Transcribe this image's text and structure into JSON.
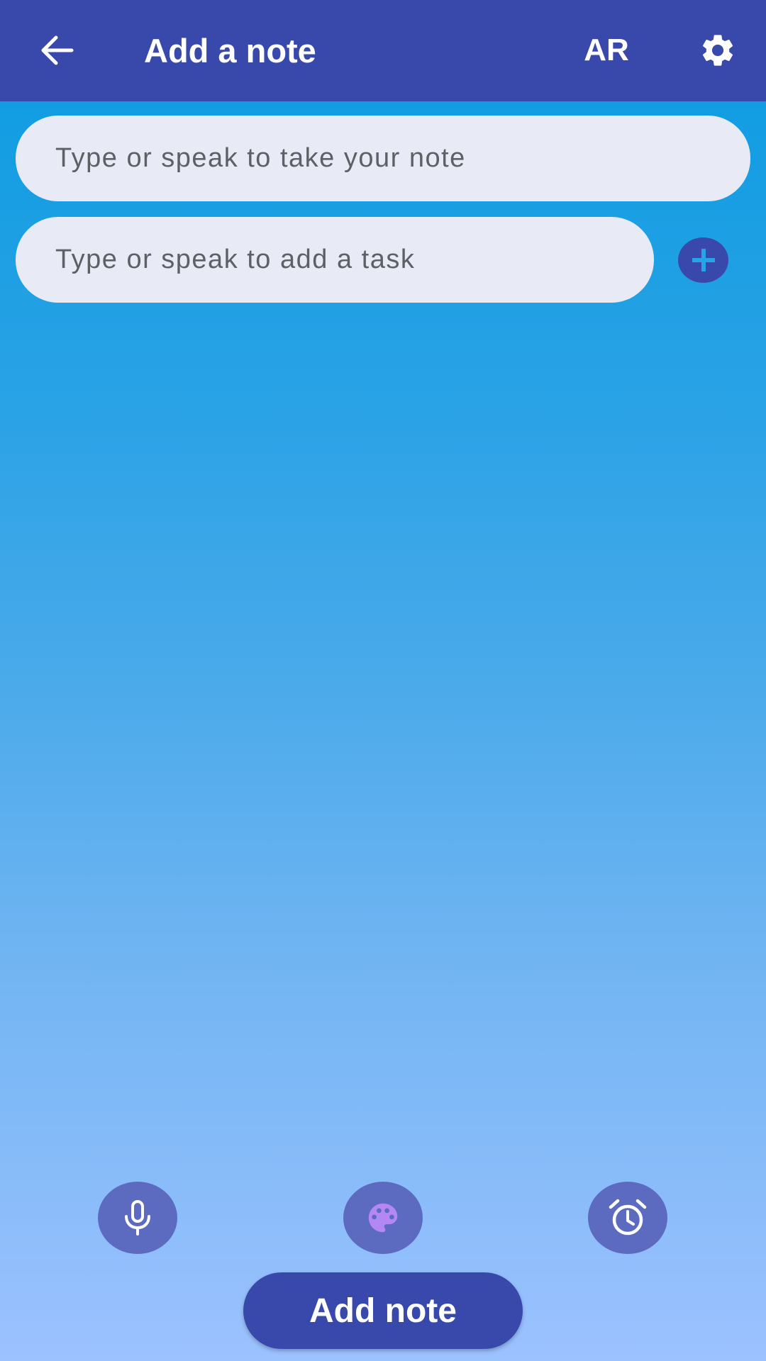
{
  "appbar": {
    "title": "Add a note",
    "back_icon": "arrow-back-icon",
    "language_label": "AR",
    "settings_icon": "gear-icon"
  },
  "note_input": {
    "value": "",
    "placeholder": "Type or speak to take your note"
  },
  "task_input": {
    "value": "",
    "placeholder": "Type or speak to add a task",
    "add_icon": "plus-icon"
  },
  "toolbar": {
    "mic_icon": "microphone-icon",
    "palette_icon": "palette-icon",
    "alarm_icon": "alarm-clock-icon"
  },
  "add_note_button": {
    "label": "Add note"
  },
  "colors": {
    "primary": "#3949ab",
    "secondary": "#5c6bc0",
    "field_background": "#e8eaf6",
    "accent_plus": "#29a3e8",
    "palette_purple": "#b388f5",
    "gradient_top": "#0a9be0",
    "gradient_bottom": "#9cc2ff"
  }
}
